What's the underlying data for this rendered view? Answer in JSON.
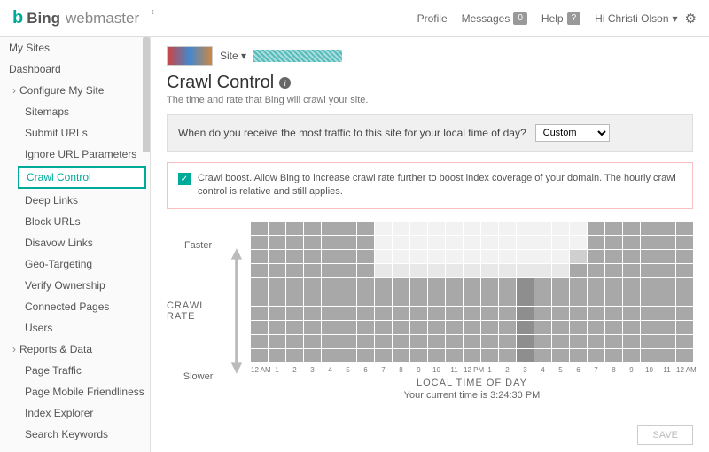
{
  "header": {
    "brand_prefix": "b",
    "brand": "Bing",
    "brand_suffix": "webmaster",
    "profile": "Profile",
    "messages": "Messages",
    "messages_count": "0",
    "help": "Help",
    "help_badge": "?",
    "user_greeting": "Hi Christi Olson",
    "user_caret": "▾"
  },
  "sidebar": {
    "items": [
      {
        "label": "My Sites",
        "level": 0,
        "exp": ""
      },
      {
        "label": "Dashboard",
        "level": 0,
        "exp": ""
      },
      {
        "label": "Configure My Site",
        "level": 1,
        "exp": "col"
      },
      {
        "label": "Sitemaps",
        "level": 2,
        "exp": ""
      },
      {
        "label": "Submit URLs",
        "level": 2,
        "exp": ""
      },
      {
        "label": "Ignore URL Parameters",
        "level": 2,
        "exp": ""
      },
      {
        "label": "Crawl Control",
        "level": 2,
        "exp": "",
        "active": true
      },
      {
        "label": "Deep Links",
        "level": 2,
        "exp": ""
      },
      {
        "label": "Block URLs",
        "level": 2,
        "exp": ""
      },
      {
        "label": "Disavow Links",
        "level": 2,
        "exp": ""
      },
      {
        "label": "Geo-Targeting",
        "level": 2,
        "exp": ""
      },
      {
        "label": "Verify Ownership",
        "level": 2,
        "exp": ""
      },
      {
        "label": "Connected Pages",
        "level": 2,
        "exp": ""
      },
      {
        "label": "Users",
        "level": 2,
        "exp": ""
      },
      {
        "label": "Reports & Data",
        "level": 1,
        "exp": "col"
      },
      {
        "label": "Page Traffic",
        "level": 2,
        "exp": ""
      },
      {
        "label": "Page Mobile Friendliness",
        "level": 2,
        "exp": ""
      },
      {
        "label": "Index Explorer",
        "level": 2,
        "exp": ""
      },
      {
        "label": "Search Keywords",
        "level": 2,
        "exp": ""
      }
    ]
  },
  "crumb": {
    "site_label": "Site ▾"
  },
  "page": {
    "title": "Crawl Control",
    "subtitle": "The time and rate that Bing will crawl your site.",
    "traffic_question": "When do you receive the most traffic to this site for your local time of day?",
    "traffic_select": "Custom",
    "boost_text": "Crawl boost. Allow Bing to increase crawl rate further to boost index coverage of your domain. The hourly crawl control is relative and still applies.",
    "yaxis_top": "Faster",
    "yaxis_mid": "CRAWL RATE",
    "yaxis_bottom": "Slower",
    "xaxis_title": "LOCAL TIME OF DAY",
    "current_time": "Your current time is 3:24:30 PM",
    "save": "SAVE"
  },
  "chart_data": {
    "type": "heatmap",
    "xlabel": "LOCAL TIME OF DAY",
    "ylabel": "CRAWL RATE",
    "ylim_labels": [
      "Slower",
      "Faster"
    ],
    "hours": [
      "12 AM",
      "1",
      "2",
      "3",
      "4",
      "5",
      "6",
      "7",
      "8",
      "9",
      "10",
      "11",
      "12 PM",
      "1",
      "2",
      "3",
      "4",
      "5",
      "6",
      "7",
      "8",
      "9",
      "10",
      "11",
      "12 AM"
    ],
    "levels_comment": "value 0=lightest .. 9=darkest, 10 rows top(faster) to bottom(slower)",
    "grid": [
      [
        8,
        8,
        8,
        8,
        8,
        8,
        8,
        2,
        2,
        2,
        2,
        2,
        2,
        2,
        2,
        2,
        2,
        2,
        2,
        8,
        8,
        8,
        8,
        8,
        8
      ],
      [
        8,
        8,
        8,
        8,
        8,
        8,
        8,
        2,
        2,
        2,
        2,
        2,
        2,
        2,
        2,
        2,
        2,
        2,
        2,
        8,
        8,
        8,
        8,
        8,
        8
      ],
      [
        8,
        8,
        8,
        8,
        8,
        8,
        8,
        2,
        2,
        2,
        2,
        2,
        2,
        2,
        2,
        2,
        2,
        2,
        5,
        8,
        8,
        8,
        8,
        8,
        8
      ],
      [
        8,
        8,
        8,
        8,
        8,
        8,
        8,
        3,
        3,
        3,
        3,
        3,
        3,
        3,
        3,
        3,
        3,
        3,
        8,
        8,
        8,
        8,
        8,
        8,
        8
      ],
      [
        8,
        8,
        8,
        8,
        8,
        8,
        8,
        8,
        8,
        8,
        8,
        8,
        8,
        8,
        8,
        9,
        8,
        8,
        8,
        8,
        8,
        8,
        8,
        8,
        8
      ],
      [
        8,
        8,
        8,
        8,
        8,
        8,
        8,
        8,
        8,
        8,
        8,
        8,
        8,
        8,
        8,
        9,
        8,
        8,
        8,
        8,
        8,
        8,
        8,
        8,
        8
      ],
      [
        8,
        8,
        8,
        8,
        8,
        8,
        8,
        8,
        8,
        8,
        8,
        8,
        8,
        8,
        8,
        9,
        8,
        8,
        8,
        8,
        8,
        8,
        8,
        8,
        8
      ],
      [
        8,
        8,
        8,
        8,
        8,
        8,
        8,
        8,
        8,
        8,
        8,
        8,
        8,
        8,
        8,
        9,
        8,
        8,
        8,
        8,
        8,
        8,
        8,
        8,
        8
      ],
      [
        8,
        8,
        8,
        8,
        8,
        8,
        8,
        8,
        8,
        8,
        8,
        8,
        8,
        8,
        8,
        9,
        8,
        8,
        8,
        8,
        8,
        8,
        8,
        8,
        8
      ],
      [
        8,
        8,
        8,
        8,
        8,
        8,
        8,
        8,
        8,
        8,
        8,
        8,
        8,
        8,
        8,
        9,
        8,
        8,
        8,
        8,
        8,
        8,
        8,
        8,
        8
      ]
    ],
    "shade_map": {
      "2": "#f2f2f2",
      "3": "#e8e8e8",
      "5": "#cfcfcf",
      "8": "#a8a8a8",
      "9": "#8e8e8e"
    }
  }
}
